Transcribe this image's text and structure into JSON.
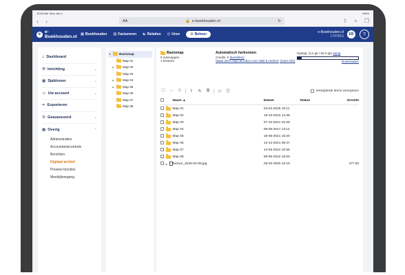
{
  "status": {
    "time": "12:00 AM",
    "date": "Mon Jan 1",
    "battery": "100%"
  },
  "browser": {
    "aa": "AA",
    "url": "e-boekhouden.nl"
  },
  "app": {
    "logo": "e-Boekhouden.nl",
    "menu": [
      {
        "label": "Boekhouden",
        "icon": "book-icon"
      },
      {
        "label": "Factureren",
        "icon": "invoice-icon"
      },
      {
        "label": "Relaties",
        "icon": "people-icon"
      },
      {
        "label": "Uren",
        "icon": "clock-icon"
      },
      {
        "label": "Beheer",
        "icon": "gear-icon"
      }
    ],
    "account_name": "e-Boekhouden.nl",
    "account_number": "1797815",
    "avatar_initials": "EB",
    "help": "?"
  },
  "sidebar": {
    "items": [
      {
        "label": "Dashboard"
      },
      {
        "label": "Inrichting"
      },
      {
        "label": "Sjablonen"
      },
      {
        "label": "Uw account"
      },
      {
        "label": "Exporteren"
      },
      {
        "label": "Geavanceerd"
      },
      {
        "label": "Overig"
      }
    ],
    "sub": [
      "Administraties",
      "Accountantscontrole",
      "Berichten",
      "Digitaal archief",
      "Preview functies",
      "Meekijktoegang"
    ]
  },
  "tree": {
    "root": "Basismap",
    "children": [
      "Map 01",
      "Map 02",
      "Map 03",
      "Map 04",
      "Map 05",
      "Map 06",
      "Map 07",
      "Map 08"
    ]
  },
  "info": {
    "folder_title": "Basismap",
    "submaps": "8 submappen",
    "files": "1 bestand",
    "auto_title": "Automatisch herkennen",
    "credits_label": "Credits:",
    "credits_value": "0",
    "credits_link": "(bestellen)",
    "inbox_text": "Maak deze map uw inbox voor 'Mail & Herken'",
    "inbox_link": "(meer info)",
    "storage_label": "Opslag: (3.4 gb / 50.0 gb)",
    "storage_link": "wijzig",
    "storage_fraction": 0.07,
    "download": "Downloaden"
  },
  "toolbar": {
    "show_deleted": "Verwijderde items weergeven"
  },
  "table": {
    "headers": {
      "name": "Naam",
      "date": "Datum",
      "status": "Status",
      "size": "Grootte"
    },
    "rows": [
      {
        "name": "Map 01",
        "date": "04-02-2025 15:11",
        "status": "",
        "size": "",
        "type": "folder"
      },
      {
        "name": "Map 02",
        "date": "19-10-2022 14:48",
        "status": "",
        "size": "",
        "type": "folder"
      },
      {
        "name": "Map 03",
        "date": "07-10-2021 10:28",
        "status": "",
        "size": "",
        "type": "folder"
      },
      {
        "name": "Map 04",
        "date": "09-05-2017 13:14",
        "status": "",
        "size": "",
        "type": "folder"
      },
      {
        "name": "Map 05",
        "date": "19-05-2021 15:20",
        "status": "",
        "size": "",
        "type": "folder"
      },
      {
        "name": "Map 06",
        "date": "14-12-2021 08:47",
        "status": "",
        "size": "",
        "type": "folder"
      },
      {
        "name": "Map 07",
        "date": "14-05-2024 10:56",
        "status": "",
        "size": "",
        "type": "folder"
      },
      {
        "name": "Map 08",
        "date": "09-05-2022 15:00",
        "status": "",
        "size": "",
        "type": "folder"
      },
      {
        "name": "factuur_2025-02-05.jpg",
        "date": "05-02-2025 10:15",
        "status": "",
        "size": "277 kb",
        "type": "file"
      }
    ]
  }
}
